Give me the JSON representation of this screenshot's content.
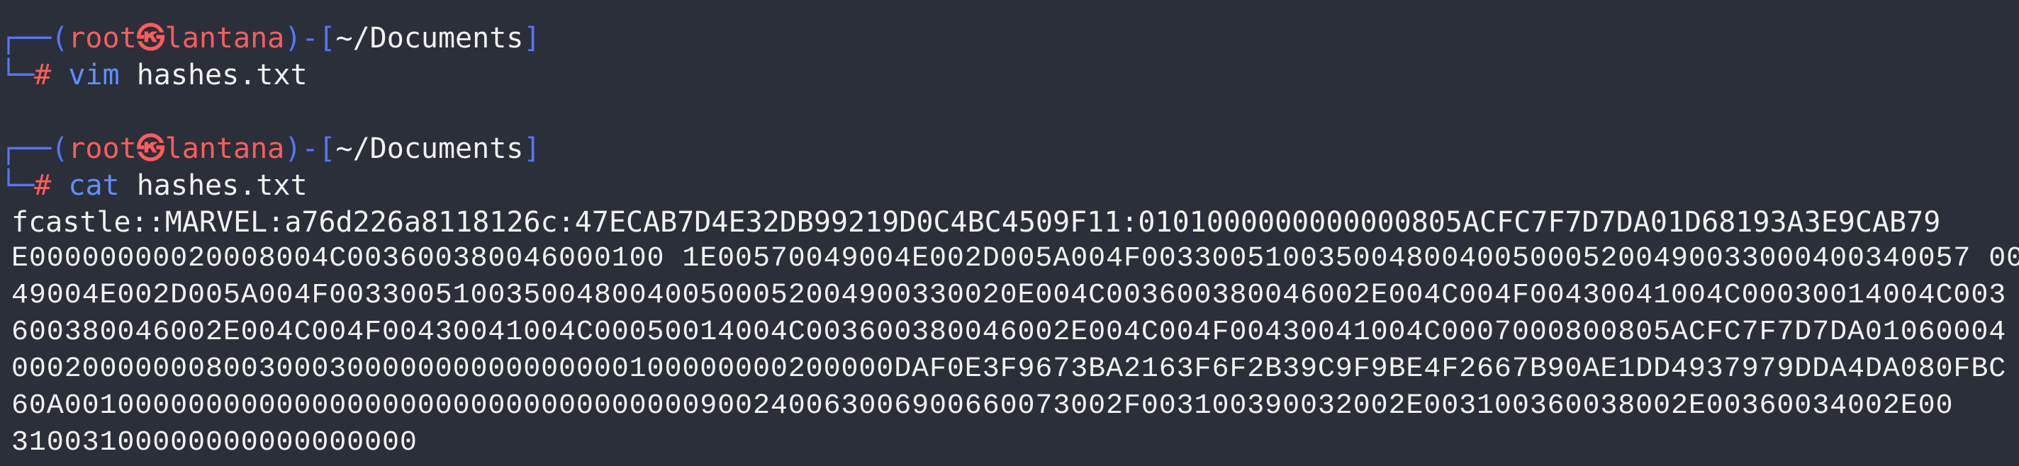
{
  "prompts": [
    {
      "frame_top": "┌──(",
      "user": "root",
      "symbol": "㉿",
      "host": "lantana",
      "frame_mid": ")-[",
      "cwd": "~/Documents",
      "frame_end": "]",
      "frame_bottom": "└─",
      "mark": "#",
      "cmd": "vim",
      "arg": "hashes.txt"
    },
    {
      "frame_top": "┌──(",
      "user": "root",
      "symbol": "㉿",
      "host": "lantana",
      "frame_mid": ")-[",
      "cwd": "~/Documents",
      "frame_end": "]",
      "frame_bottom": "└─",
      "mark": "#",
      "cmd": "cat",
      "arg": "hashes.txt"
    }
  ],
  "output": [
    "fcastle::MARVEL:a76d226a8118126c:47ECAB7D4E32DB99219D0C4BC4509F11:0101000000000000805ACFC7F7D7DA01D68193A3E9CAB79",
    "E00000000020008004C003600380046000100 1E00570049004E002D005A004F00330051003500480040050005200490033000400340057 00",
    "49004E002D005A004F003300510035004800400500052004900330020E004C003600380046002E004C004F00430041004C00030014004C003",
    "600380046002E004C004F00430041004C00050014004C003600380046002E004C004F00430041004C0007000800805ACFC7F7D7DA01060004",
    "00020000000800300030000000000000000100000000200000DAF0E3F9673BA2163F6F2B39C9F9BE4F2667B90AE1DD4937979DDA4DA080FBC",
    "60A001000000000000000000000000000000000900240063006900660073002F003100390032002E003100360038002E00360034002E00",
    "31003100000000000000000"
  ]
}
